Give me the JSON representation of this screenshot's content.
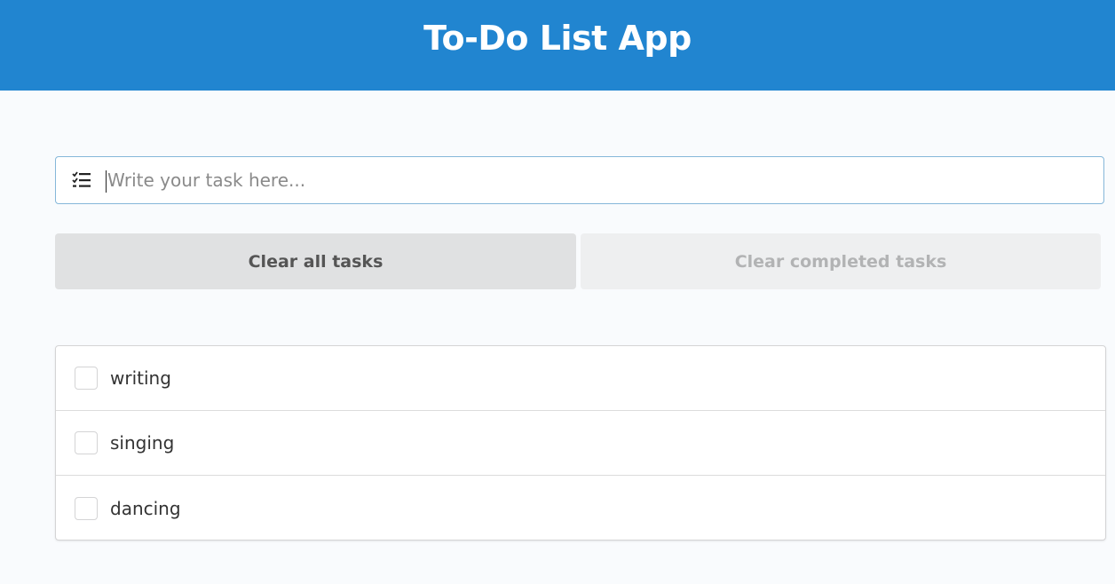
{
  "app": {
    "title": "To-Do List App"
  },
  "colors": {
    "header_bg": "#2185d0",
    "input_border": "#85b7d9",
    "clear_all_bg": "#e0e1e2",
    "clear_completed_bg": "#eeeff0"
  },
  "task_input": {
    "value": "",
    "placeholder": "Write your task here...",
    "icon": "tasks-list-icon"
  },
  "actions": {
    "clear_all_label": "Clear all tasks",
    "clear_completed_label": "Clear completed tasks"
  },
  "tasks": [
    {
      "label": "writing",
      "completed": false
    },
    {
      "label": "singing",
      "completed": false
    },
    {
      "label": "dancing",
      "completed": false
    }
  ]
}
